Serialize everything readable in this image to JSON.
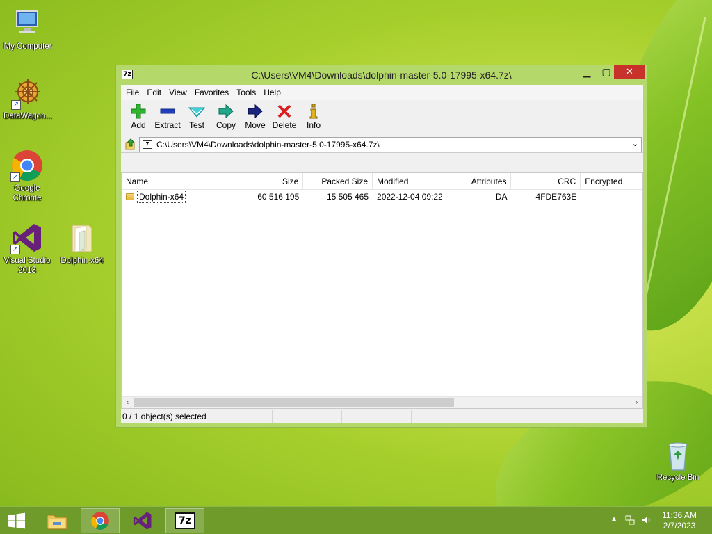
{
  "desktop": {
    "icons": [
      {
        "label": "My Computer"
      },
      {
        "label": "DataWagon..."
      },
      {
        "label": "Google Chrome"
      },
      {
        "label": "Visual Studio 2013"
      },
      {
        "label": "Dolphin-x64"
      },
      {
        "label": "Recycle Bin"
      }
    ]
  },
  "window": {
    "title": "C:\\Users\\VM4\\Downloads\\dolphin-master-5.0-17995-x64.7z\\",
    "app_icon_text": "7z",
    "menu": [
      "File",
      "Edit",
      "View",
      "Favorites",
      "Tools",
      "Help"
    ],
    "toolbar": {
      "add": "Add",
      "extract": "Extract",
      "test": "Test",
      "copy": "Copy",
      "move": "Move",
      "delete": "Delete",
      "info": "Info"
    },
    "address": "C:\\Users\\VM4\\Downloads\\dolphin-master-5.0-17995-x64.7z\\",
    "columns": [
      "Name",
      "Size",
      "Packed Size",
      "Modified",
      "Attributes",
      "CRC",
      "Encrypted"
    ],
    "rows": [
      {
        "name": "Dolphin-x64",
        "size": "60 516 195",
        "packed": "15 505 465",
        "modified": "2022-12-04 09:22",
        "attributes": "DA",
        "crc": "4FDE763E",
        "encrypted": ""
      }
    ],
    "status": "0 / 1 object(s) selected"
  },
  "taskbar": {
    "time": "11:36 AM",
    "date": "2/7/2023",
    "active_app_text": "7z"
  },
  "colors": {
    "close_button": "#c7322b",
    "window_frame": "#b5d86a",
    "taskbar": "#6e9b2a"
  }
}
